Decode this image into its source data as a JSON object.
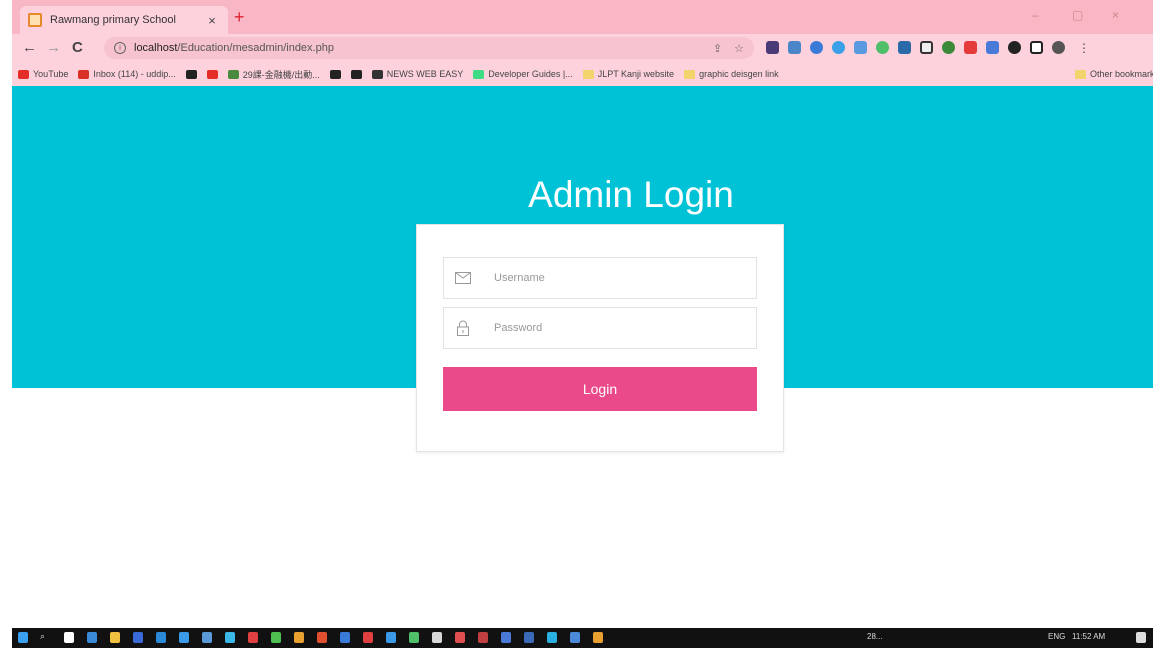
{
  "browser": {
    "tab_title": "Rawmang primary School",
    "tab_close": "×",
    "new_tab": "+",
    "url_host": "localhost",
    "url_path": "/Education/mesadmin/index.php",
    "window_controls": [
      "–",
      "▢",
      "×"
    ]
  },
  "bookmarks": [
    {
      "label": "YouTube",
      "color": "#e52d27"
    },
    {
      "label": "Inbox (114) - uddip...",
      "color": "#d93025"
    },
    {
      "label": "",
      "color": "#222222"
    },
    {
      "label": "",
      "color": "#e52d27"
    },
    {
      "label": "29課-金融機/出動...",
      "color": "#4a8a3c"
    },
    {
      "label": "",
      "color": "#222222"
    },
    {
      "label": "",
      "color": "#222222"
    },
    {
      "label": "NEWS WEB EASY",
      "color": "#333333"
    },
    {
      "label": "Developer Guides |...",
      "color": "#3ddc84"
    },
    {
      "label": "JLPT Kanji website",
      "folder": true
    },
    {
      "label": "graphic deisgen link",
      "folder": true
    },
    {
      "label": "Other bookmarks",
      "folder": true
    }
  ],
  "page": {
    "heading": "Admin Login",
    "username_placeholder": "Username",
    "password_placeholder": "Password",
    "login_label": "Login"
  },
  "colors": {
    "hero": "#00c2d6",
    "button": "#ea4a8a",
    "chrome": "#fdd2dc"
  },
  "taskbar": {
    "weather": "28...",
    "language": "ENG",
    "time": "11:52 AM"
  }
}
